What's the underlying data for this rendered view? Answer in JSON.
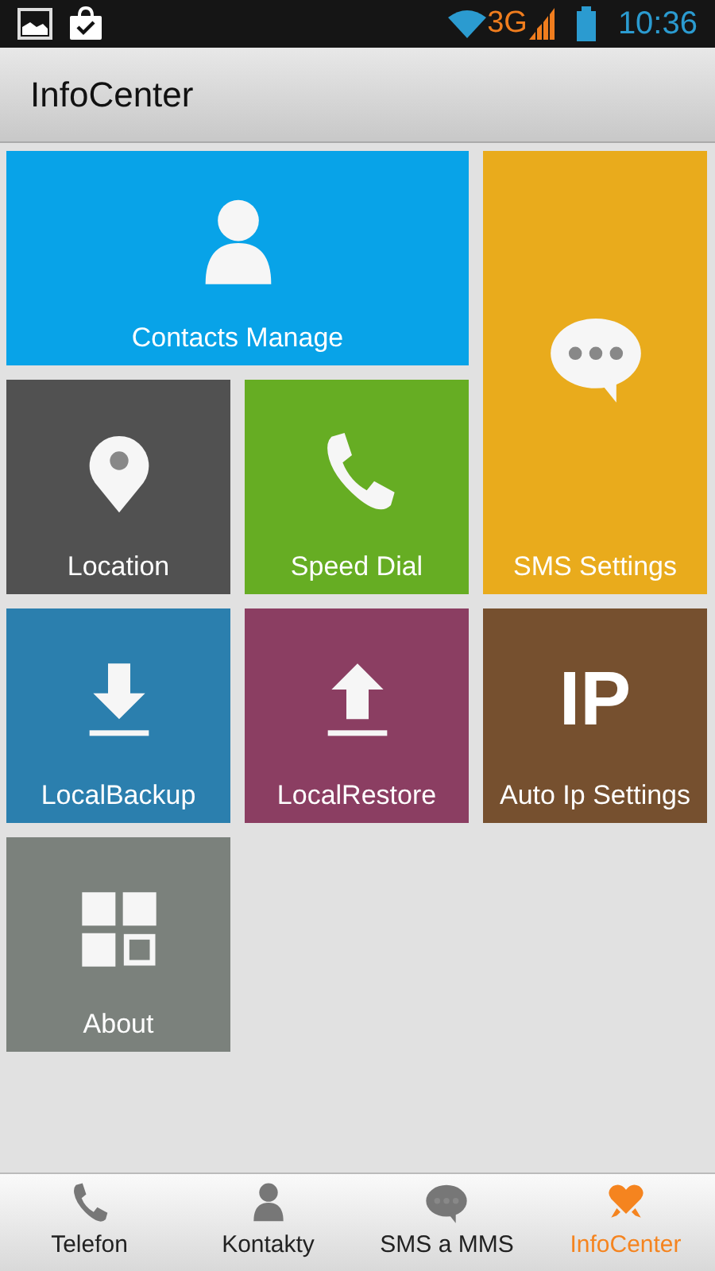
{
  "status_bar": {
    "network": "3G",
    "time": "10:36"
  },
  "app_bar": {
    "title": "InfoCenter"
  },
  "tiles": [
    {
      "label": "Contacts Manage",
      "kind": "person",
      "wide": true,
      "tall": false,
      "color": "#08a3e8"
    },
    {
      "label": "Location",
      "kind": "pin",
      "wide": false,
      "tall": false,
      "color": "#515151"
    },
    {
      "label": "Speed Dial",
      "kind": "phone",
      "wide": false,
      "tall": false,
      "color": "#66ad23"
    },
    {
      "label": "SMS Settings",
      "kind": "chat",
      "wide": false,
      "tall": true,
      "color": "#e9ab1c"
    },
    {
      "label": "LocalBackup",
      "kind": "download",
      "wide": false,
      "tall": false,
      "color": "#2b7fae"
    },
    {
      "label": "LocalRestore",
      "kind": "upload",
      "wide": false,
      "tall": false,
      "color": "#8b3e62"
    },
    {
      "label": "Auto Ip Settings",
      "kind": "glyph",
      "glyph": "IP",
      "wide": false,
      "tall": false,
      "color": "#76502f"
    },
    {
      "label": "About",
      "kind": "apps",
      "wide": false,
      "tall": false,
      "color": "#7b817c"
    }
  ],
  "bottom_nav": [
    {
      "label": "Telefon",
      "kind": "phone",
      "selected": false
    },
    {
      "label": "Kontakty",
      "kind": "person",
      "selected": false
    },
    {
      "label": "SMS a MMS",
      "kind": "chat",
      "selected": false
    },
    {
      "label": "InfoCenter",
      "kind": "heart",
      "selected": true
    }
  ]
}
